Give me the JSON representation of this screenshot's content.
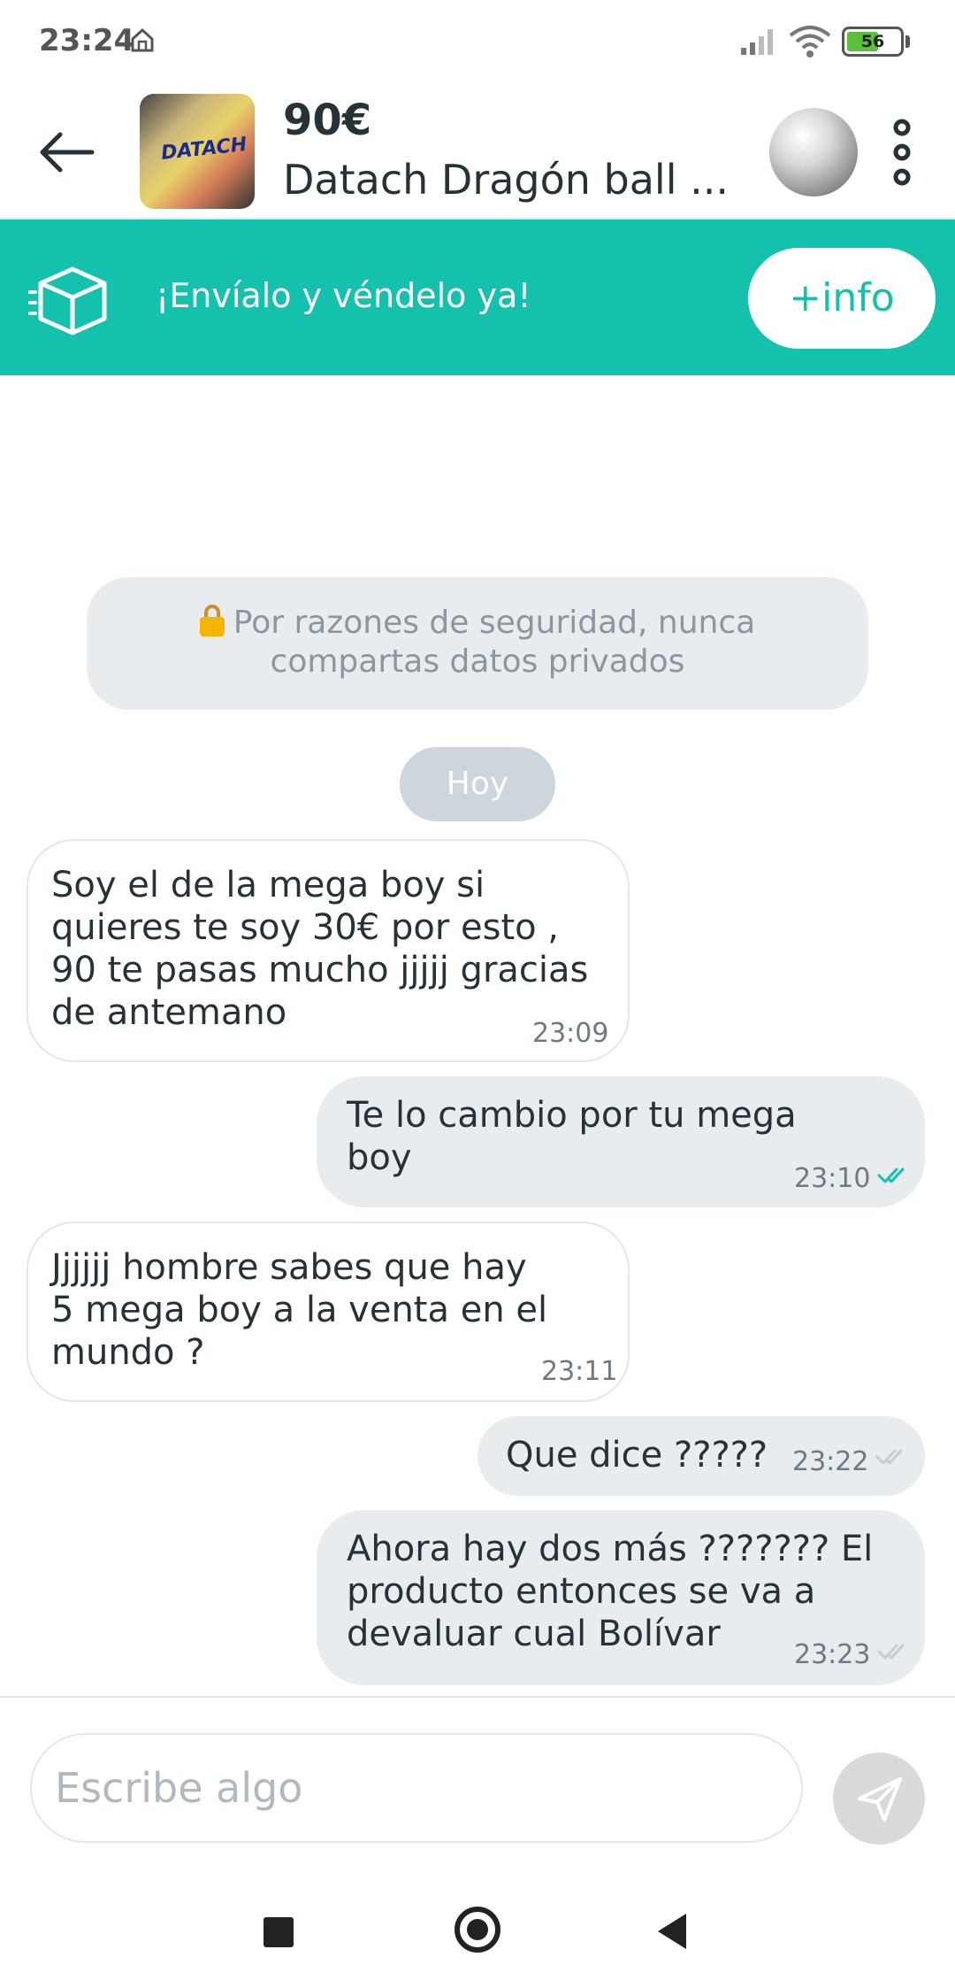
{
  "status_bar": {
    "time": "23:24",
    "battery_level": "56",
    "icons": [
      "home-icon",
      "signal-icon",
      "wifi-icon",
      "battery-icon"
    ]
  },
  "header": {
    "back_icon": "arrow-left-icon",
    "thumbnail_text": "DATACH",
    "price": "90€",
    "title": "Datach Dragón ball ...",
    "more_icon": "more-vertical-icon"
  },
  "banner": {
    "icon": "box-icon",
    "text": "¡Envíalo y véndelo ya!",
    "button_label": "+info",
    "color": "#13c1ac"
  },
  "security_notice": {
    "line1": "Por razones de seguridad, nunca",
    "line2": "compartas datos privados"
  },
  "day_label": "Hoy",
  "messages": [
    {
      "direction": "in",
      "lines": [
        "Soy el de la mega boy si",
        "quieres te soy 30€ por esto ,",
        "90 te pasas mucho jjjjj gracias",
        "de antemano"
      ],
      "time": "23:09"
    },
    {
      "direction": "out",
      "lines": [
        "Te lo cambio por tu mega",
        "boy"
      ],
      "time": "23:10",
      "read": true
    },
    {
      "direction": "in",
      "lines": [
        "Jjjjjj hombre sabes que hay",
        "5 mega boy a la venta en el",
        "mundo ?"
      ],
      "time": "23:11"
    },
    {
      "direction": "out",
      "lines": [
        "Que dice ?????"
      ],
      "time": "23:22",
      "read": false
    },
    {
      "direction": "out",
      "lines": [
        "Ahora hay dos más ???????  El",
        "producto entonces se va a",
        "devaluar cual Bolívar"
      ],
      "time": "23:23",
      "read": false
    }
  ],
  "composer": {
    "placeholder": "Escribe algo",
    "send_icon": "send-icon"
  },
  "colors": {
    "accent": "#13c1ac",
    "read_ticks": "#13c1ac",
    "unread_ticks": "#c5ced4",
    "outgoing_bubble": "#e8ecef"
  }
}
